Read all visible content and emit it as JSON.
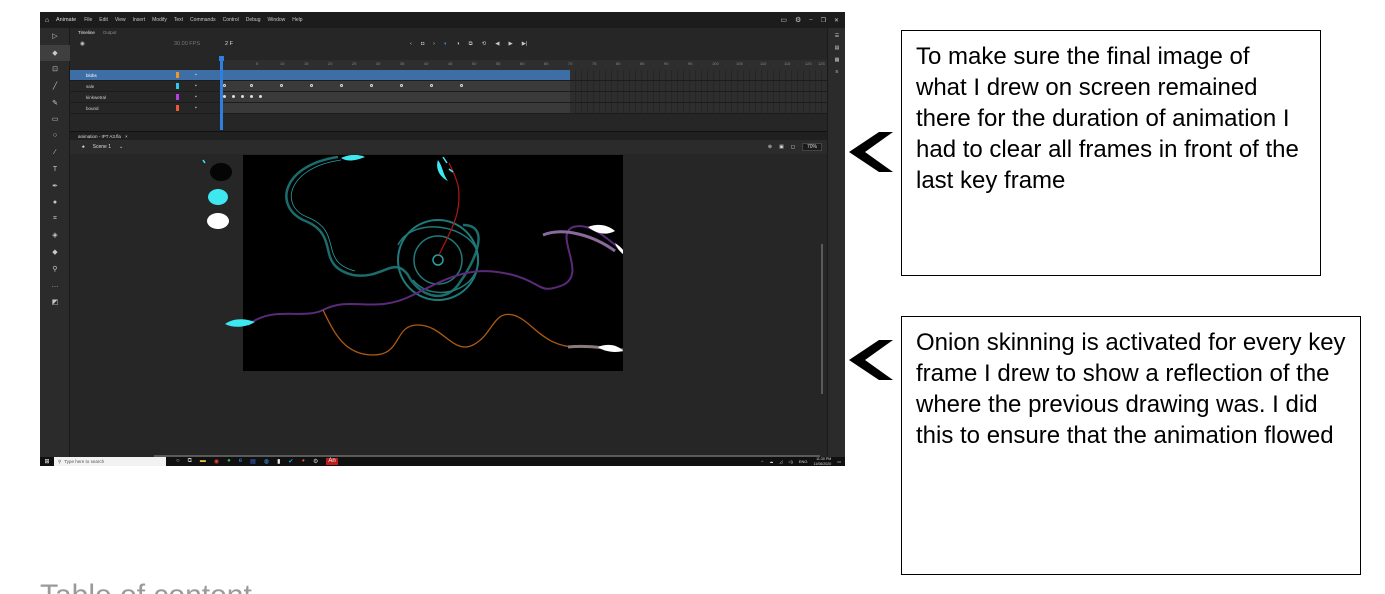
{
  "menubar": {
    "app_name": "Animate",
    "menus": [
      "File",
      "Edit",
      "View",
      "Insert",
      "Modify",
      "Text",
      "Commands",
      "Control",
      "Debug",
      "Window",
      "Help"
    ]
  },
  "timeline": {
    "tabs": [
      "Timeline",
      "Output"
    ],
    "fps": "30.00 FPS",
    "current_frame": "2 F",
    "ruler_ticks": [
      "5",
      "10",
      "15",
      "20",
      "25",
      "30",
      "35",
      "40",
      "45",
      "50",
      "55",
      "60",
      "65",
      "70",
      "75",
      "80",
      "85",
      "90",
      "95",
      "100",
      "105",
      "110",
      "115",
      "120",
      "125"
    ],
    "layers": [
      {
        "name": "blobs",
        "color": "#f0952a",
        "selected": true
      },
      {
        "name": "sale",
        "color": "#2ec7f0",
        "selected": false
      },
      {
        "name": "kinkwetral",
        "color": "#b640e8",
        "selected": false
      },
      {
        "name": "bound",
        "color": "#f0563a",
        "selected": false
      }
    ]
  },
  "document": {
    "tab_label": "animation - IPT A3.fla",
    "scene_label": "Scene 1",
    "zoom": "70%"
  },
  "taskbar": {
    "search_placeholder": "Type here to search",
    "language": "ENG",
    "time": "11:30 PM",
    "date": "11/06/2020"
  },
  "callouts": {
    "frames_note": "To make sure the final image of what I drew on screen remained there for the duration of animation I had to clear all frames in front of the last key frame",
    "onion_note": "Onion skinning is activated for every key frame I drew to show a reflection of the where the previous drawing was. I did this to ensure that the animation flowed"
  },
  "footer": {
    "heading": "Table of content"
  },
  "colors": {
    "app_bg": "#262626",
    "stage_bg": "#000000",
    "selection": "#3d6ea5",
    "accent": "#2e7fe0"
  }
}
